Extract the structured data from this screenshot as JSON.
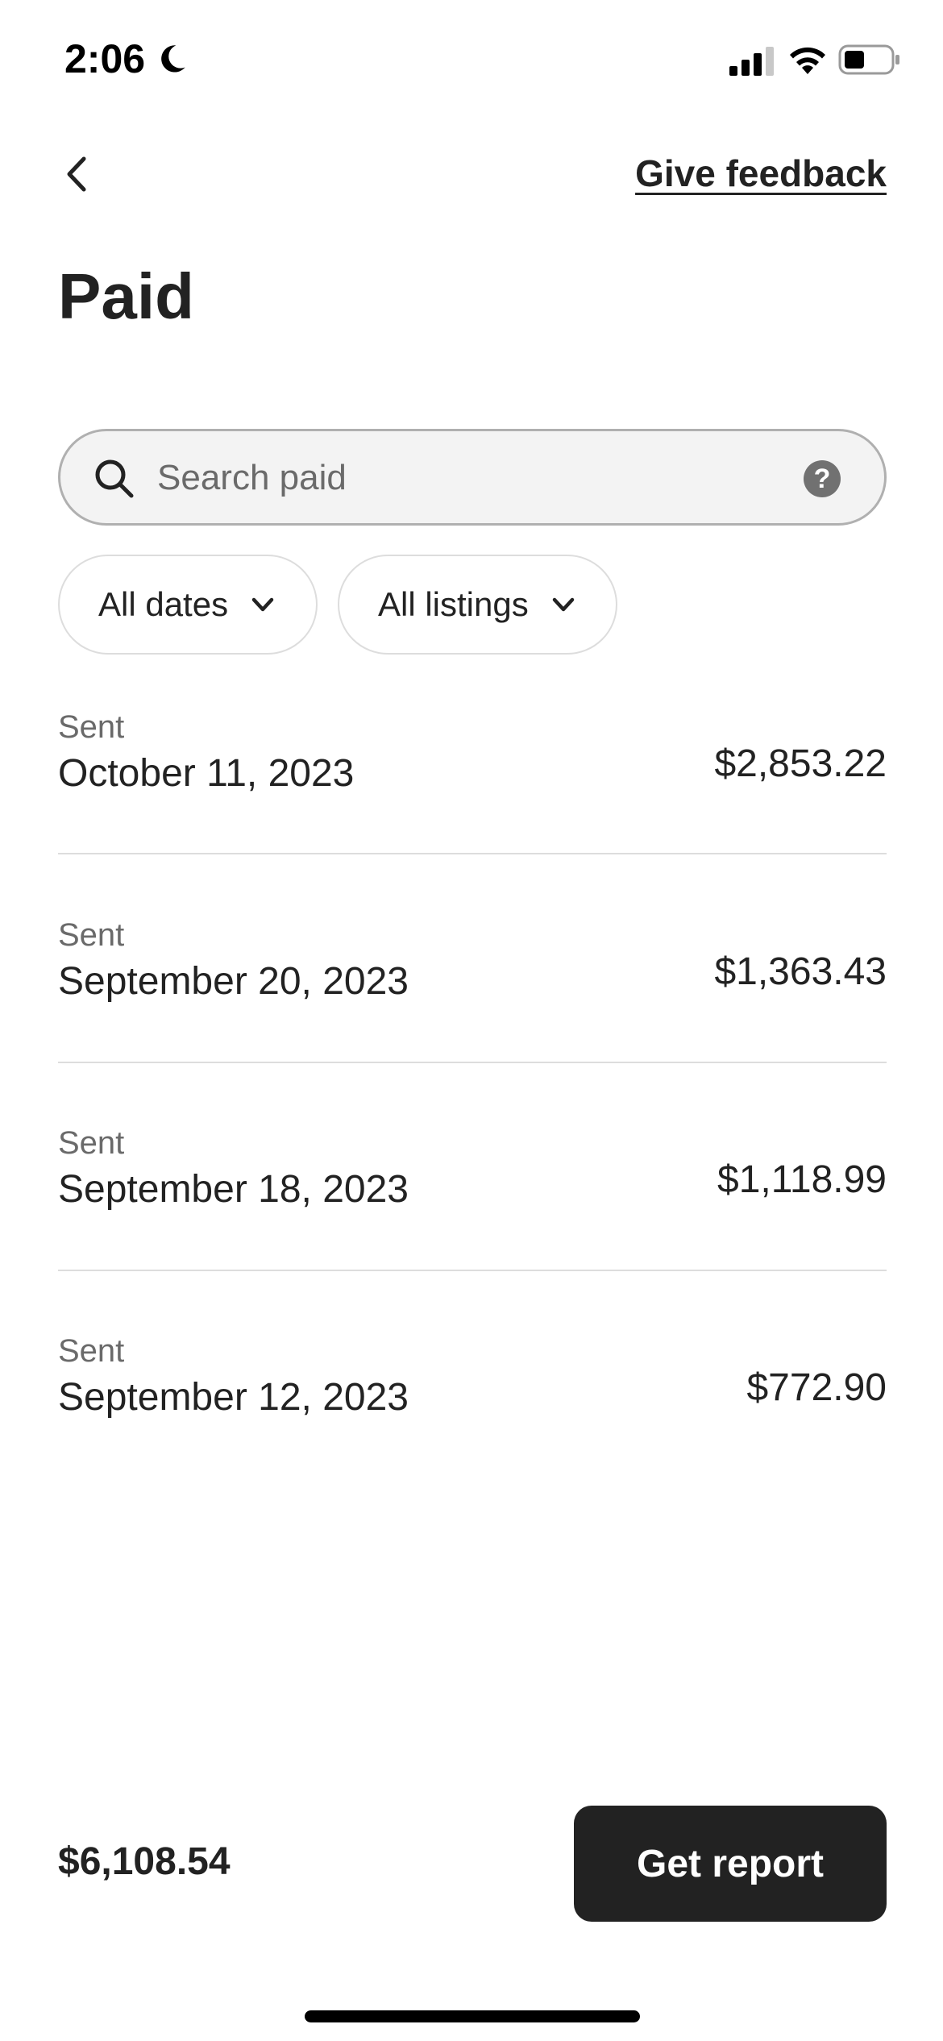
{
  "status_bar": {
    "time": "2:06",
    "icons": [
      "moon-icon",
      "cellular-signal-icon",
      "wifi-icon",
      "battery-icon"
    ]
  },
  "header": {
    "back_icon": "chevron-left-icon",
    "feedback_label": "Give feedback",
    "title": "Paid"
  },
  "search": {
    "placeholder": "Search paid",
    "value": "",
    "help_icon_glyph": "?"
  },
  "filters": [
    {
      "label": "All dates",
      "icon": "chevron-down-icon"
    },
    {
      "label": "All listings",
      "icon": "chevron-down-icon"
    }
  ],
  "payouts": [
    {
      "status": "Sent",
      "date": "October 11, 2023",
      "amount": "$2,853.22"
    },
    {
      "status": "Sent",
      "date": "September 20, 2023",
      "amount": "$1,363.43"
    },
    {
      "status": "Sent",
      "date": "September 18, 2023",
      "amount": "$1,118.99"
    },
    {
      "status": "Sent",
      "date": "September 12, 2023",
      "amount": "$772.90"
    }
  ],
  "footer": {
    "total": "$6,108.54",
    "report_button_label": "Get report"
  },
  "colors": {
    "text_primary": "#222222",
    "text_secondary": "#6a6a6a",
    "button_bg": "#222222",
    "divider": "#dddddd",
    "search_bg": "#f3f3f3"
  }
}
